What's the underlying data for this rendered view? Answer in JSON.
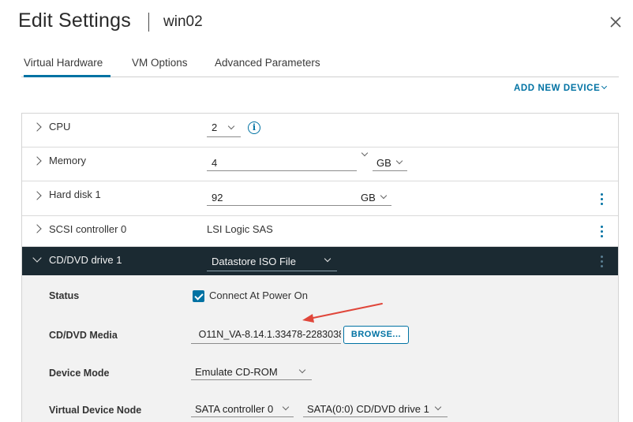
{
  "header": {
    "title": "Edit Settings",
    "vm_name": "win02"
  },
  "tabs": [
    {
      "label": "Virtual Hardware",
      "active": true
    },
    {
      "label": "VM Options",
      "active": false
    },
    {
      "label": "Advanced Parameters",
      "active": false
    }
  ],
  "toolbar": {
    "add_new_device": "ADD NEW DEVICE"
  },
  "rows": {
    "cpu": {
      "label": "CPU",
      "value": "2"
    },
    "memory": {
      "label": "Memory",
      "value": "4",
      "unit": "GB"
    },
    "hard_disk": {
      "label": "Hard disk 1",
      "value": "92",
      "unit": "GB"
    },
    "scsi": {
      "label": "SCSI controller 0",
      "value": "LSI Logic SAS"
    },
    "cdrom": {
      "label": "CD/DVD drive 1",
      "type": "Datastore ISO File",
      "status_label": "Status",
      "connect_label": "Connect At Power On",
      "connect_checked": true,
      "media_label": "CD/DVD Media",
      "media_value": "O11N_VA-8.14.1.33478-2283038",
      "browse_label": "BROWSE...",
      "device_mode_label": "Device Mode",
      "device_mode_value": "Emulate CD-ROM",
      "node_label": "Virtual Device Node",
      "node_controller": "SATA controller 0",
      "node_slot": "SATA(0:0) CD/DVD drive 1"
    }
  },
  "colors": {
    "accent": "#0072a3",
    "header_row": "#1b2a32",
    "annotation_arrow": "#e0463a"
  },
  "icons": {
    "close": "close-icon",
    "info": "info-icon",
    "expand": "chevron-right-icon",
    "collapse": "chevron-down-icon",
    "more": "kebab-icon"
  }
}
